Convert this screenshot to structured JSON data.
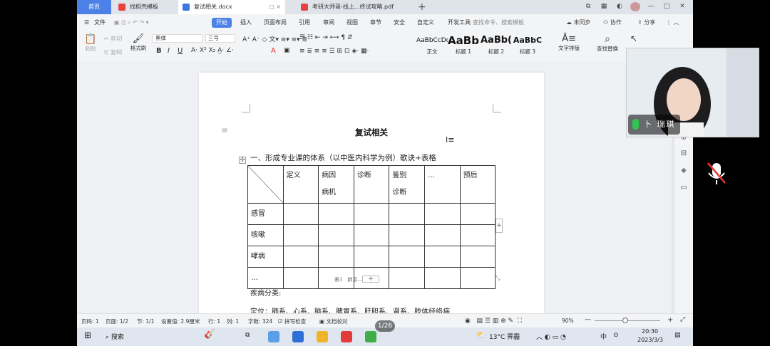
{
  "tabs": {
    "home": "首页",
    "tab1": "找稻壳模板",
    "tab2": "复试相关.docx",
    "tab3": "考研大师哥-线上...终试攻略.pdf"
  },
  "menu": {
    "file": "文件",
    "start": "开始",
    "items": [
      "插入",
      "页面布局",
      "引用",
      "审阅",
      "视图",
      "章节",
      "安全",
      "自定义",
      "开发工具"
    ],
    "search": "查找命令、搜索模板",
    "unsynced": "未同步",
    "collab": "协作",
    "share": "分享"
  },
  "ribbon": {
    "paste": "粘贴",
    "cut": "剪切",
    "copy": "复制",
    "format_painter": "格式刷",
    "font_name": "黑体",
    "font_size": "三号",
    "styles": [
      {
        "sample": "AaBbCcDd",
        "label": "正文"
      },
      {
        "sample": "AaBb",
        "label": "标题 1"
      },
      {
        "sample": "AaBb(",
        "label": "标题 2"
      },
      {
        "sample": "AaBbC",
        "label": "标题 3"
      }
    ],
    "text_layout": "文字排版",
    "find_replace": "查找替换"
  },
  "document": {
    "title": "复试相关",
    "heading1": "一、形成专业课的体系（以中医内科学为例）歌诀+表格",
    "table": {
      "headers": [
        "定义",
        "病因\n病机",
        "诊断",
        "鉴别\n诊断",
        "…",
        "预后"
      ],
      "rows": [
        "感冒",
        "咳嗽",
        "哮病",
        "…"
      ]
    },
    "caption": "表1　肺系…疾病",
    "para1": "疾病分类:",
    "para2": "定位：肺系、心系、脑系、脾胃系、肝胆系、肾系、肢体经络病"
  },
  "webcam": {
    "name": "卜 瑞琪"
  },
  "status": {
    "page": "页码: 1",
    "pages": "页面: 1/2",
    "section": "节: 1/1",
    "setting": "设置值: 2.9厘米",
    "row": "行: 1",
    "col": "列: 1",
    "words": "字数: 324",
    "spell": "拼写检查",
    "proof": "文档校对",
    "zoom": "90%",
    "page_indicator": "1/26"
  },
  "taskbar": {
    "search": "搜索",
    "weather": "13°C 霁霾",
    "time": "20:30",
    "date": "2023/3/3",
    "ime": "中"
  },
  "colors": {
    "accent": "#4c82e8",
    "tab_bar": "#dfe3ea",
    "taskbar": "#dfe6ef"
  }
}
